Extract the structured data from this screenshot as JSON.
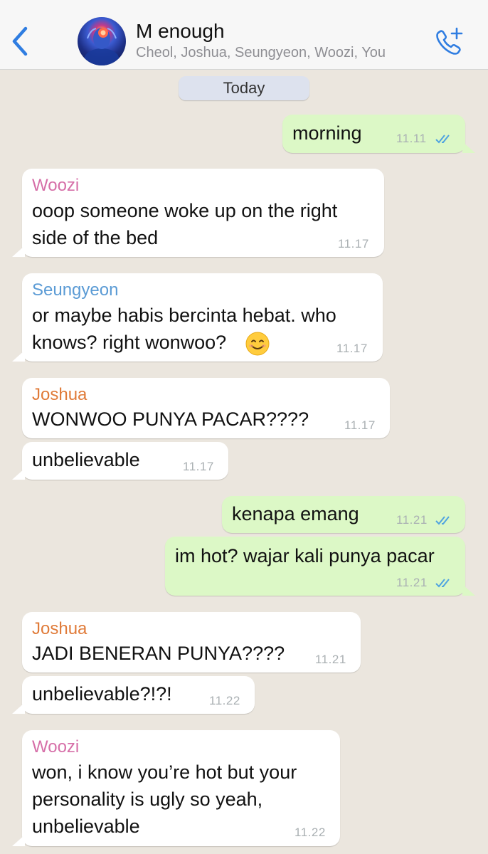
{
  "header": {
    "title": "M enough",
    "subtitle": "Cheol, Joshua, Seungyeon, Woozi, You"
  },
  "date_label": "Today",
  "colors": {
    "accent": "#2f7de1",
    "woozi": "#d66fa8",
    "seungyeon": "#5b9bd5",
    "joshua": "#e07b39",
    "read_ticks": "#4fa3e0"
  },
  "messages": [
    {
      "dir": "out",
      "text": "morning",
      "time": "11.11",
      "status": "read"
    },
    {
      "dir": "in",
      "sender": "Woozi",
      "text_lines": [
        "ooop someone woke up on the right",
        "side of the bed"
      ],
      "time": "11.17"
    },
    {
      "dir": "in",
      "sender": "Seungyeon",
      "text_lines": [
        "or maybe habis bercinta hebat. who",
        "knows? right wonwoo?"
      ],
      "emoji": "smiling-face",
      "time": "11.17"
    },
    {
      "dir": "in",
      "sender": "Joshua",
      "text": "WONWOO PUNYA PACAR????",
      "time": "11.17"
    },
    {
      "dir": "in",
      "text": "unbelievable",
      "time": "11.17"
    },
    {
      "dir": "out",
      "text": "kenapa emang",
      "time": "11.21",
      "status": "read"
    },
    {
      "dir": "out",
      "text": "im hot? wajar kali punya pacar",
      "time": "11.21",
      "status": "read"
    },
    {
      "dir": "in",
      "sender": "Joshua",
      "text": "JADI BENERAN PUNYA????",
      "time": "11.21"
    },
    {
      "dir": "in",
      "text": "unbelievable?!?!",
      "time": "11.22"
    },
    {
      "dir": "in",
      "sender": "Woozi",
      "text_lines": [
        "won, i know you’re hot but your",
        "personality is ugly so yeah,",
        "unbelievable"
      ],
      "time": "11.22"
    }
  ]
}
